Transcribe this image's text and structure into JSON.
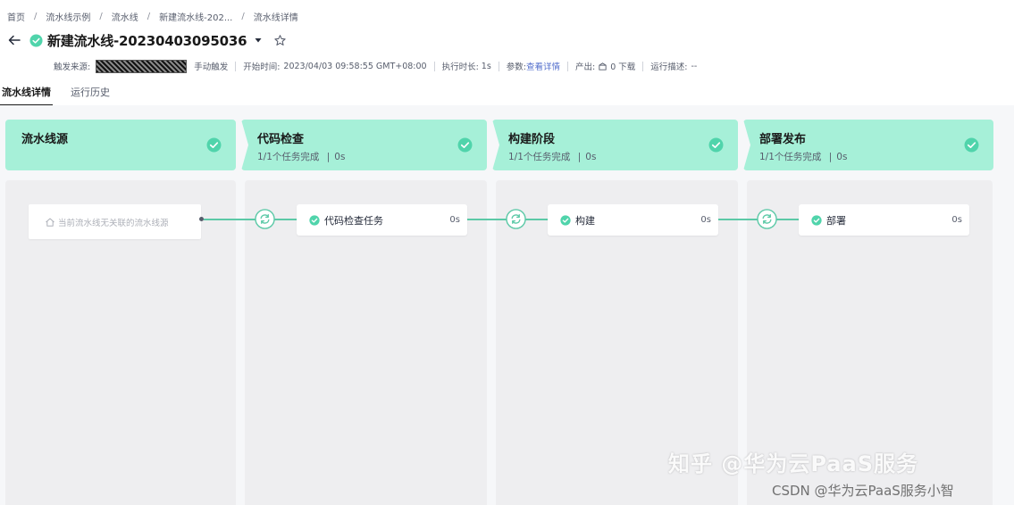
{
  "breadcrumb": [
    "首页",
    "流水线示例",
    "流水线",
    "新建流水线-202...",
    "流水线详情"
  ],
  "breadcrumb_sep": "/",
  "title": "新建流水线-20230403095036",
  "meta": {
    "trigger_source_label": "触发来源:",
    "trigger_type": "手动触发",
    "start_time_label": "开始时间:",
    "start_time": "2023/04/03 09:58:55 GMT+08:00",
    "duration_label": "执行时长:",
    "duration": "1s",
    "params_label": "参数:",
    "params_link": "查看详情",
    "output_label": "产出:",
    "output_value": "0 下载",
    "run_desc_label": "运行描述:",
    "run_desc": "--"
  },
  "tabs": [
    "流水线详情",
    "运行历史"
  ],
  "source": {
    "title": "流水线源",
    "empty_text": "当前流水线无关联的流水线源"
  },
  "stages": [
    {
      "title": "代码检查",
      "progress": "1/1个任务完成",
      "duration": "0s",
      "job": {
        "name": "代码检查任务",
        "duration": "0s"
      }
    },
    {
      "title": "构建阶段",
      "progress": "1/1个任务完成",
      "duration": "0s",
      "job": {
        "name": "构建",
        "duration": "0s"
      }
    },
    {
      "title": "部署发布",
      "progress": "1/1个任务完成",
      "duration": "0s",
      "job": {
        "name": "部署",
        "duration": "0s"
      }
    }
  ],
  "stage_sub_sep": "|",
  "watermark": {
    "line1": "知乎 @华为云PaaS服务",
    "line2": "CSDN @华为云PaaS服务小智"
  },
  "colors": {
    "success": "#50d4ab",
    "stage_header": "#a6f0d8",
    "connector": "#5cc9a7",
    "link": "#526ecc"
  },
  "icons": {
    "back": "arrow-left-icon",
    "status": "check-circle-icon",
    "caret": "caret-down-icon",
    "favorite": "star-outline-icon",
    "output": "package-icon",
    "source": "home-icon",
    "node": "refresh-circle-icon"
  }
}
